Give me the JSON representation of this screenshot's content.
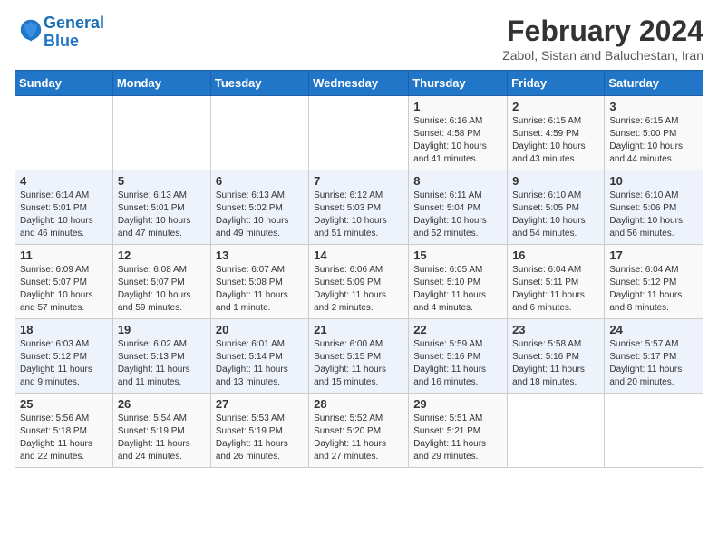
{
  "header": {
    "logo_line1": "General",
    "logo_line2": "Blue",
    "title": "February 2024",
    "subtitle": "Zabol, Sistan and Baluchestan, Iran"
  },
  "weekdays": [
    "Sunday",
    "Monday",
    "Tuesday",
    "Wednesday",
    "Thursday",
    "Friday",
    "Saturday"
  ],
  "weeks": [
    [
      {
        "day": "",
        "info": ""
      },
      {
        "day": "",
        "info": ""
      },
      {
        "day": "",
        "info": ""
      },
      {
        "day": "",
        "info": ""
      },
      {
        "day": "1",
        "info": "Sunrise: 6:16 AM\nSunset: 4:58 PM\nDaylight: 10 hours\nand 41 minutes."
      },
      {
        "day": "2",
        "info": "Sunrise: 6:15 AM\nSunset: 4:59 PM\nDaylight: 10 hours\nand 43 minutes."
      },
      {
        "day": "3",
        "info": "Sunrise: 6:15 AM\nSunset: 5:00 PM\nDaylight: 10 hours\nand 44 minutes."
      }
    ],
    [
      {
        "day": "4",
        "info": "Sunrise: 6:14 AM\nSunset: 5:01 PM\nDaylight: 10 hours\nand 46 minutes."
      },
      {
        "day": "5",
        "info": "Sunrise: 6:13 AM\nSunset: 5:01 PM\nDaylight: 10 hours\nand 47 minutes."
      },
      {
        "day": "6",
        "info": "Sunrise: 6:13 AM\nSunset: 5:02 PM\nDaylight: 10 hours\nand 49 minutes."
      },
      {
        "day": "7",
        "info": "Sunrise: 6:12 AM\nSunset: 5:03 PM\nDaylight: 10 hours\nand 51 minutes."
      },
      {
        "day": "8",
        "info": "Sunrise: 6:11 AM\nSunset: 5:04 PM\nDaylight: 10 hours\nand 52 minutes."
      },
      {
        "day": "9",
        "info": "Sunrise: 6:10 AM\nSunset: 5:05 PM\nDaylight: 10 hours\nand 54 minutes."
      },
      {
        "day": "10",
        "info": "Sunrise: 6:10 AM\nSunset: 5:06 PM\nDaylight: 10 hours\nand 56 minutes."
      }
    ],
    [
      {
        "day": "11",
        "info": "Sunrise: 6:09 AM\nSunset: 5:07 PM\nDaylight: 10 hours\nand 57 minutes."
      },
      {
        "day": "12",
        "info": "Sunrise: 6:08 AM\nSunset: 5:07 PM\nDaylight: 10 hours\nand 59 minutes."
      },
      {
        "day": "13",
        "info": "Sunrise: 6:07 AM\nSunset: 5:08 PM\nDaylight: 11 hours\nand 1 minute."
      },
      {
        "day": "14",
        "info": "Sunrise: 6:06 AM\nSunset: 5:09 PM\nDaylight: 11 hours\nand 2 minutes."
      },
      {
        "day": "15",
        "info": "Sunrise: 6:05 AM\nSunset: 5:10 PM\nDaylight: 11 hours\nand 4 minutes."
      },
      {
        "day": "16",
        "info": "Sunrise: 6:04 AM\nSunset: 5:11 PM\nDaylight: 11 hours\nand 6 minutes."
      },
      {
        "day": "17",
        "info": "Sunrise: 6:04 AM\nSunset: 5:12 PM\nDaylight: 11 hours\nand 8 minutes."
      }
    ],
    [
      {
        "day": "18",
        "info": "Sunrise: 6:03 AM\nSunset: 5:12 PM\nDaylight: 11 hours\nand 9 minutes."
      },
      {
        "day": "19",
        "info": "Sunrise: 6:02 AM\nSunset: 5:13 PM\nDaylight: 11 hours\nand 11 minutes."
      },
      {
        "day": "20",
        "info": "Sunrise: 6:01 AM\nSunset: 5:14 PM\nDaylight: 11 hours\nand 13 minutes."
      },
      {
        "day": "21",
        "info": "Sunrise: 6:00 AM\nSunset: 5:15 PM\nDaylight: 11 hours\nand 15 minutes."
      },
      {
        "day": "22",
        "info": "Sunrise: 5:59 AM\nSunset: 5:16 PM\nDaylight: 11 hours\nand 16 minutes."
      },
      {
        "day": "23",
        "info": "Sunrise: 5:58 AM\nSunset: 5:16 PM\nDaylight: 11 hours\nand 18 minutes."
      },
      {
        "day": "24",
        "info": "Sunrise: 5:57 AM\nSunset: 5:17 PM\nDaylight: 11 hours\nand 20 minutes."
      }
    ],
    [
      {
        "day": "25",
        "info": "Sunrise: 5:56 AM\nSunset: 5:18 PM\nDaylight: 11 hours\nand 22 minutes."
      },
      {
        "day": "26",
        "info": "Sunrise: 5:54 AM\nSunset: 5:19 PM\nDaylight: 11 hours\nand 24 minutes."
      },
      {
        "day": "27",
        "info": "Sunrise: 5:53 AM\nSunset: 5:19 PM\nDaylight: 11 hours\nand 26 minutes."
      },
      {
        "day": "28",
        "info": "Sunrise: 5:52 AM\nSunset: 5:20 PM\nDaylight: 11 hours\nand 27 minutes."
      },
      {
        "day": "29",
        "info": "Sunrise: 5:51 AM\nSunset: 5:21 PM\nDaylight: 11 hours\nand 29 minutes."
      },
      {
        "day": "",
        "info": ""
      },
      {
        "day": "",
        "info": ""
      }
    ]
  ]
}
